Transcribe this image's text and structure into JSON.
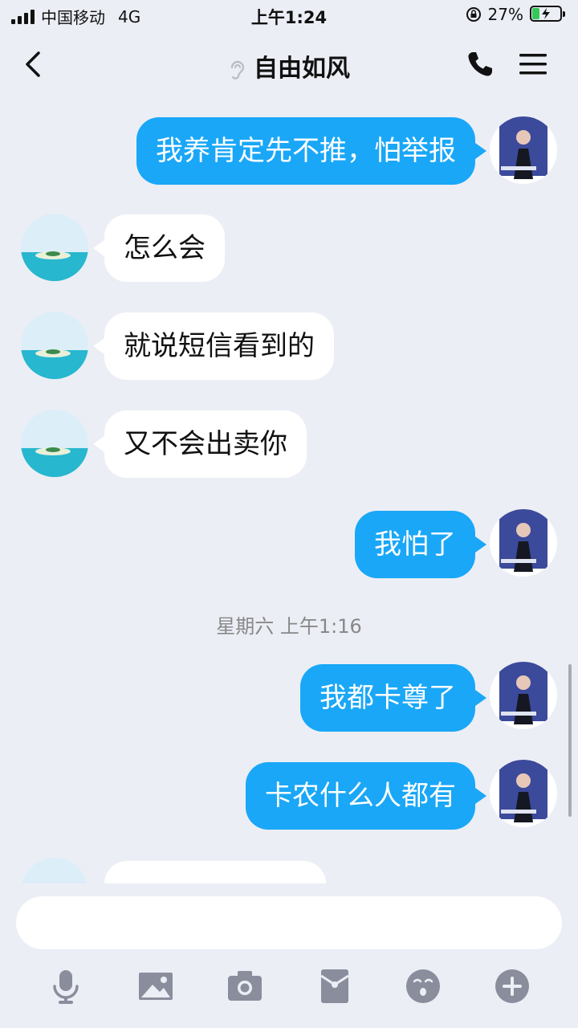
{
  "status_bar": {
    "carrier": "中国移动",
    "network": "4G",
    "time": "上午1:24",
    "battery": "27%",
    "battery_level": 0.27
  },
  "header": {
    "title": "自由如风"
  },
  "messages": [
    {
      "sender": "me",
      "text": "我养肯定先不推，怕举报"
    },
    {
      "sender": "friend",
      "text": "怎么会"
    },
    {
      "sender": "friend",
      "text": "就说短信看到的"
    },
    {
      "sender": "friend",
      "text": "又不会出卖你"
    },
    {
      "sender": "me",
      "text": "我怕了"
    },
    {
      "sender": "me",
      "text": "我都卡尊了"
    },
    {
      "sender": "me",
      "text": "卡农什么人都有"
    }
  ],
  "timestamp": "星期六 上午1:16",
  "colors": {
    "accent": "#1aa7f7",
    "background": "#eceef6",
    "toolbar_icon": "#8a8e9c"
  },
  "toolbar": {
    "icons": [
      "microphone-icon",
      "image-icon",
      "camera-icon",
      "red-packet-icon",
      "emoji-icon",
      "plus-icon"
    ]
  }
}
